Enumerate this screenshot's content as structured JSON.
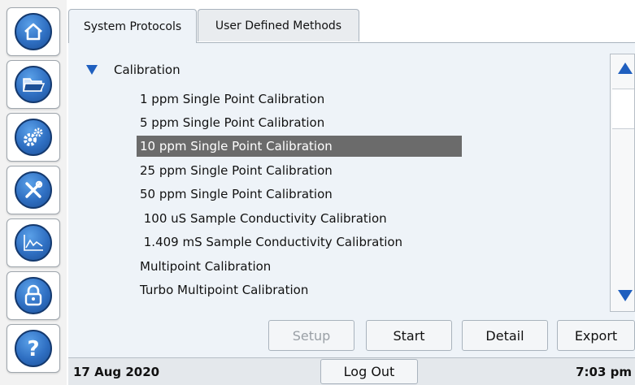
{
  "tabs": [
    {
      "label": "System Protocols",
      "active": true
    },
    {
      "label": "User Defined Methods",
      "active": false
    }
  ],
  "tree": {
    "group_label": "Calibration",
    "expanded": true,
    "items": [
      {
        "label": "1 ppm Single Point Calibration",
        "selected": false
      },
      {
        "label": "5 ppm Single Point Calibration",
        "selected": false
      },
      {
        "label": "10 ppm Single Point Calibration",
        "selected": true
      },
      {
        "label": "25 ppm Single Point Calibration",
        "selected": false
      },
      {
        "label": "50 ppm Single Point Calibration",
        "selected": false
      },
      {
        "label": " 100 uS Sample Conductivity Calibration",
        "selected": false
      },
      {
        "label": " 1.409 mS Sample Conductivity Calibration",
        "selected": false
      },
      {
        "label": "Multipoint Calibration",
        "selected": false
      },
      {
        "label": "Turbo Multipoint Calibration",
        "selected": false
      }
    ]
  },
  "actions": {
    "setup": "Setup",
    "start": "Start",
    "detail": "Detail",
    "export": "Export"
  },
  "status": {
    "date": "17 Aug 2020",
    "logout": "Log Out",
    "time": "7:03 pm"
  },
  "nav_icons": [
    "home-icon",
    "folder-icon",
    "gears-icon",
    "tools-icon",
    "chart-icon",
    "lock-icon",
    "help-icon"
  ],
  "colors": {
    "accent": "#2f6fc2",
    "selection": "#6b6b6b",
    "panel": "#eef3f8"
  }
}
